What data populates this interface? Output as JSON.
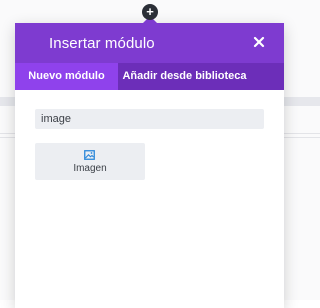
{
  "modal": {
    "title": "Insertar módulo",
    "close_icon": "close-icon",
    "add_icon": "plus-icon",
    "tabs": [
      {
        "label": "Nuevo módulo",
        "active": true
      },
      {
        "label": "Añadir desde biblioteca",
        "active": false
      }
    ],
    "search": {
      "value": "image",
      "placeholder": ""
    },
    "modules": [
      {
        "label": "Imagen",
        "icon": "image-icon"
      }
    ]
  },
  "colors": {
    "header": "#7e3bd0",
    "tabs_bg": "#6c2eb9",
    "tab_active": "#8f42ec",
    "module_bg": "#eceef2",
    "icon_blue": "#2b87da"
  }
}
